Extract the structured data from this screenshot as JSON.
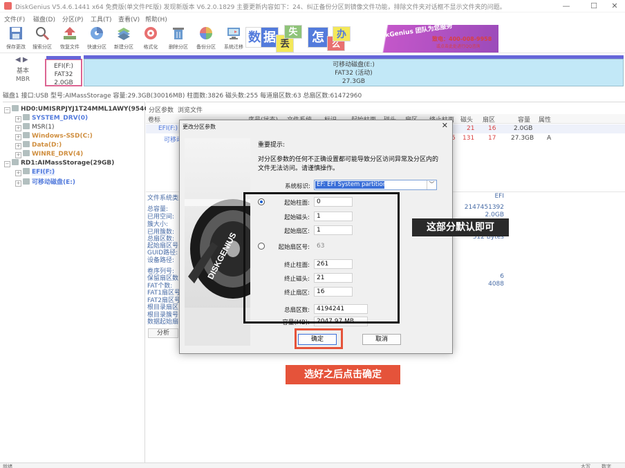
{
  "window": {
    "title": "DiskGenius V5.4.6.1441 x64 免费版(单文件PE版)   发现新版本 V6.2.0.1829    主要更新内容如下：24、纠正备份分区到镜像文件功能，排除文件夹对话框不显示文件夹的问题。",
    "minimize": "—",
    "maximize": "☐",
    "close": "✕"
  },
  "menu": [
    "文件(F)",
    "磁盘(D)",
    "分区(P)",
    "工具(T)",
    "查看(V)",
    "帮助(H)"
  ],
  "toolbar": [
    {
      "label": "保存更改",
      "icon": "save-icon"
    },
    {
      "label": "搜索分区",
      "icon": "search-partition-icon"
    },
    {
      "label": "恢复文件",
      "icon": "recover-file-icon"
    },
    {
      "label": "快速分区",
      "icon": "quick-partition-icon"
    },
    {
      "label": "新建分区",
      "icon": "new-partition-icon"
    },
    {
      "label": "格式化",
      "icon": "format-icon"
    },
    {
      "label": "删除分区",
      "icon": "delete-partition-icon"
    },
    {
      "label": "备份分区",
      "icon": "backup-partition-icon"
    },
    {
      "label": "系统迁移",
      "icon": "migrate-system-icon"
    }
  ],
  "banner": {
    "tiles": [
      "数",
      "据",
      "丢",
      "失",
      "怎",
      "么",
      "办"
    ],
    "promo_title": "DiskGenius 团队为您服务",
    "phone": "致电：400-008-9958",
    "qq": "或点击此处进行QQ咨询"
  },
  "diskmap": {
    "basic": "基本",
    "mbr": "MBR",
    "efi": {
      "name": "EFI(F:)",
      "fs": "FAT32",
      "size": "2.0GB"
    },
    "removable": {
      "name": "可移动磁盘(E:)",
      "fs": "FAT32 (活动)",
      "size": "27.3GB"
    }
  },
  "disk_info": "磁盘1 接口:USB  型号:AIMassStorage  容量:29.3GB(30016MB)  柱面数:3826  磁头数:255  每道扇区数:63  总扇区数:61472960",
  "tree": [
    {
      "text": "HD0:UMISRPJYJ1T24MML1AWY(954GB)",
      "color": "#000",
      "bold": true
    },
    {
      "text": "SYSTEM_DRV(0)",
      "color": "#1a4fd0",
      "bold": true
    },
    {
      "text": "MSR(1)",
      "color": "#000",
      "bold": false
    },
    {
      "text": "Windows-SSD(C:)",
      "color": "#c06a00",
      "bold": true
    },
    {
      "text": "Data(D:)",
      "color": "#c06a00",
      "bold": true
    },
    {
      "text": "WINRE_DRV(4)",
      "color": "#c06a00",
      "bold": true
    },
    {
      "text": "RD1:AIMassStorage(29GB)",
      "color": "#000",
      "bold": true
    },
    {
      "text": "EFI(F:)",
      "color": "#1a4fd0",
      "bold": true
    },
    {
      "text": "可移动磁盘(E:)",
      "color": "#1a4fd0",
      "bold": true
    }
  ],
  "panel": {
    "tabs": [
      "分区参数",
      "浏览文件"
    ],
    "columns": [
      "卷标",
      "序号(状态)",
      "文件系统",
      "标识",
      "起始柱面",
      "磁头",
      "扇区",
      "终止柱面",
      "磁头",
      "扇区",
      "容量",
      "属性"
    ],
    "rows": [
      {
        "label": "EFI(F:)",
        "end_head": "21",
        "end_sector": "16",
        "size": "2.0GB",
        "attr": ""
      },
      {
        "label": "可移动磁盘(E:)",
        "end_cyl": "5",
        "end_head": "131",
        "end_sector": "17",
        "size": "27.3GB",
        "attr": "A"
      }
    ],
    "info_labels": [
      "文件系统类型:",
      "总容量:",
      "已用空间:",
      "簇大小:",
      "已用簇数:",
      "总扇区数:",
      "起始扇区号:",
      "GUID路径:",
      "设备路径:",
      "卷序列号:",
      "保留扇区数:",
      "FAT个数:",
      "FAT1扇区号:",
      "FAT2扇区号:",
      "根目录扇区:",
      "根目录簇号:",
      "数据起始扇区:"
    ],
    "info_values": [
      "EFI",
      "2147451392",
      "2.0GB",
      "512 Bytes",
      "6",
      "4088"
    ],
    "analyze": "分析"
  },
  "status": {
    "left": "就绪",
    "right1": "大写",
    "right2": "数字"
  },
  "dialog": {
    "title": "更改分区参数",
    "close": "✕",
    "hint_title": "重要提示:",
    "hint": "对分区参数的任何不正确设置都可能导致分区访问异常及分区内的文件无法访问。请谨慎操作。",
    "system_id_label": "系统标识:",
    "system_id_value": "EF: EFI System partition",
    "start_cyl_label": "起始柱面:",
    "start_cyl": "0",
    "start_head_label": "起始磁头:",
    "start_head": "1",
    "start_sector_label": "起始扇区:",
    "start_sector": "1",
    "start_lba_label": "起始扇区号:",
    "start_lba": "63",
    "end_cyl_label": "终止柱面:",
    "end_cyl": "261",
    "end_head_label": "终止磁头:",
    "end_head": "21",
    "end_sector_label": "终止扇区:",
    "end_sector": "16",
    "total_sectors_label": "总扇区数:",
    "total_sectors": "4194241",
    "capacity_label": "容量(MB):",
    "capacity": "2047.97 MB",
    "ok": "确定",
    "cancel": "取消",
    "art_text": "DISKGENIUS"
  },
  "annotations": {
    "default_note": "这部分默认即可",
    "confirm_note": "选好之后点击确定"
  }
}
